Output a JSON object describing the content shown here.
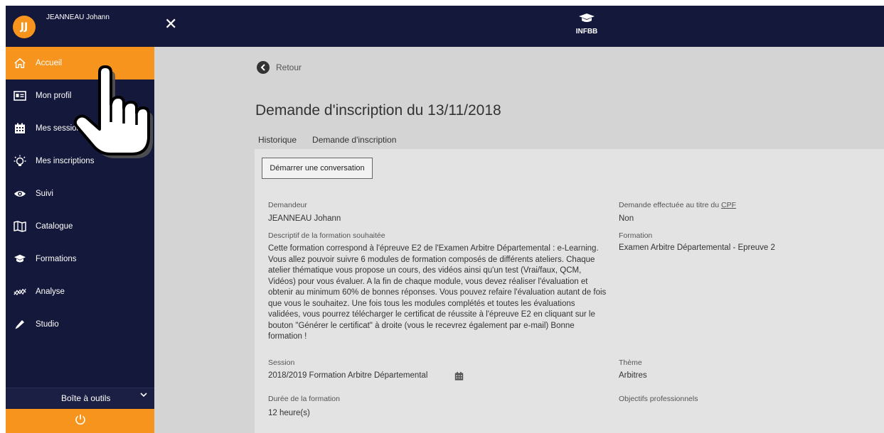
{
  "user": {
    "initials": "JJ",
    "name": "JEANNEAU Johann"
  },
  "sidebar": {
    "items": [
      {
        "label": "Accueil",
        "icon": "home-icon",
        "active": true
      },
      {
        "label": "Mon profil",
        "icon": "id-card-icon"
      },
      {
        "label": "Mes sessions",
        "icon": "calendar-icon"
      },
      {
        "label": "Mes inscriptions",
        "icon": "lightbulb-icon"
      },
      {
        "label": "Suivi",
        "icon": "eye-icon"
      },
      {
        "label": "Catalogue",
        "icon": "book-icon"
      },
      {
        "label": "Formations",
        "icon": "graduation-cap-icon"
      },
      {
        "label": "Analyse",
        "icon": "chart-line-icon"
      },
      {
        "label": "Studio",
        "icon": "pencil-icon"
      }
    ],
    "toolbox_label": "Boîte à outils"
  },
  "topbar": {
    "logo_text": "INFBB"
  },
  "main": {
    "back_label": "Retour",
    "title": "Demande d'inscription du 13/11/2018",
    "tabs": [
      "Historique",
      "Demande d'inscription"
    ],
    "active_tab": "Demande d'inscription",
    "conversation_button": "Démarrer une conversation",
    "fields": {
      "demandeur_label": "Demandeur",
      "demandeur_value": "JEANNEAU Johann",
      "cpf_label_prefix": "Demande effectuée au titre du ",
      "cpf_label_abbr": "CPF",
      "cpf_value": "Non",
      "descriptif_label": "Descriptif de la formation souhaitée",
      "descriptif_value": "Cette formation correspond à l'épreuve E2 de l'Examen Arbitre Départemental : e-Learning. Vous allez pouvoir suivre 6 modules de formation composés de différents ateliers. Chaque atelier thématique vous propose un cours, des vidéos ainsi qu'un test (Vrai/faux, QCM, Vidéos) pour vous évaluer. A la fin de chaque module, vous devez réaliser l'évaluation et obtenir au minimum 60% de bonnes réponses. Vous pouvez refaire l'évaluation autant de fois que vous le souhaitez. Une fois tous les modules complétés et toutes les évaluations validées, vous pourrez télécharger le certificat de réussite à l'épreuve E2 en cliquant sur le bouton \"Générer le certificat\" à droite (vous le recevrez également par e-mail) Bonne formation !",
      "formation_label": "Formation",
      "formation_value": "Examen Arbitre Départemental - Epreuve 2",
      "session_label": "Session",
      "session_value": "2018/2019 Formation Arbitre Départemental",
      "theme_label": "Thème",
      "theme_value": "Arbitres",
      "duree_label": "Durée de la formation",
      "duree_value": "12 heure(s)",
      "objectifs_label": "Objectifs professionnels"
    }
  },
  "colors": {
    "navy": "#14183a",
    "orange": "#f7941d",
    "content_bg": "#d4d4d4",
    "card_bg": "#e3e3e3"
  }
}
